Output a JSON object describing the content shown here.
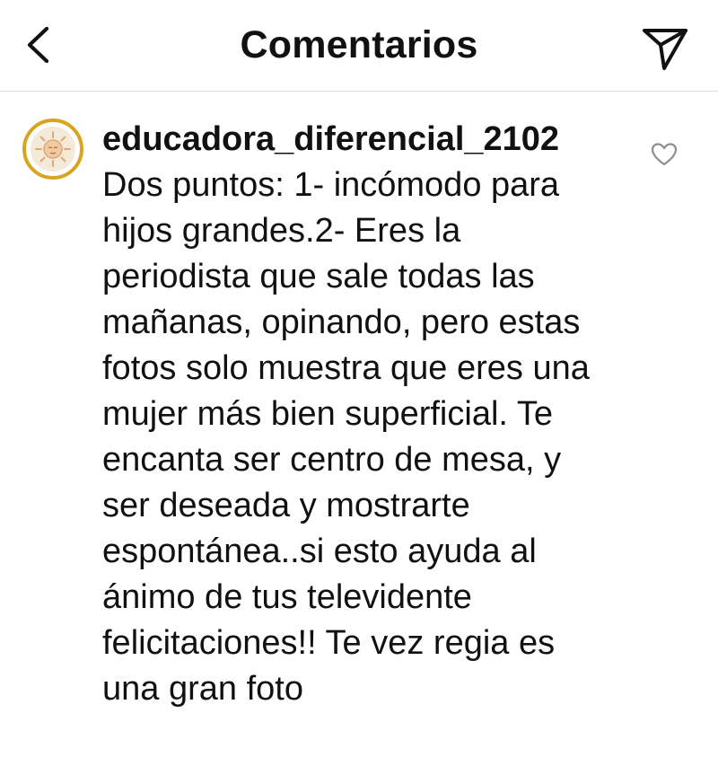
{
  "header": {
    "title": "Comentarios",
    "back_icon": "chevron-left-icon",
    "send_icon": "paper-plane-icon"
  },
  "comment": {
    "username": "educadora_diferencial_2102",
    "text": "Dos puntos:  1- incómodo para hijos grandes.2- Eres la periodista que sale todas las mañanas, opinando, pero estas fotos solo muestra que eres una mujer más bien superficial. Te encanta ser centro de mesa, y ser deseada y mostrarte espontánea..si esto ayuda al ánimo de tus televidente felicitaciones!! Te vez regia es una gran foto",
    "avatar_icon": "sun-face-icon",
    "like_icon": "heart-outline-icon"
  },
  "colors": {
    "avatar_ring": "#d9a520",
    "divider": "#dbdbdb",
    "text": "#111111"
  }
}
